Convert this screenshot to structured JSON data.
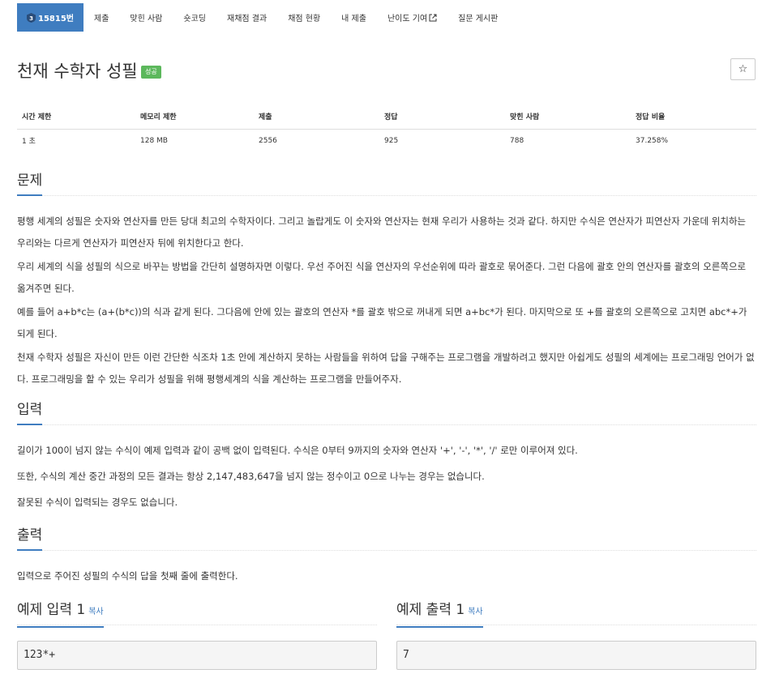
{
  "nav": {
    "problem_id": "15815번",
    "submit": "제출",
    "solved_users": "맞힌 사람",
    "short_coding": "숏코딩",
    "rejudge": "재채점 결과",
    "judge_status": "채점 현황",
    "my_submissions": "내 제출",
    "difficulty": "난이도 기여",
    "board": "질문 게시판",
    "tier_number": "3"
  },
  "header": {
    "title": "천재 수학자 성필",
    "badge": "성공",
    "star": "☆"
  },
  "info_table": {
    "headers": [
      "시간 제한",
      "메모리 제한",
      "제출",
      "정답",
      "맞힌 사람",
      "정답 비율"
    ],
    "values": [
      "1 초",
      "128 MB",
      "2556",
      "925",
      "788",
      "37.258%"
    ]
  },
  "problem": {
    "heading": "문제",
    "paragraphs": [
      "평행 세계의 성필은 숫자와 연산자를 만든 당대 최고의 수학자이다. 그리고 놀랍게도 이 숫자와 연산자는 현재 우리가 사용하는 것과 같다. 하지만 수식은 연산자가 피연산자 가운데 위치하는 우리와는 다르게 연산자가 피연산자 뒤에 위치한다고 한다.",
      "우리 세계의 식을 성필의 식으로 바꾸는 방법을 간단히 설명하자면 이렇다. 우선 주어진 식을 연산자의 우선순위에 따라 괄호로 묶어준다. 그런 다음에 괄호 안의 연산자를 괄호의 오른쪽으로 옮겨주면 된다.",
      "예를 들어 a+b*c는 (a+(b*c))의 식과 같게 된다. 그다음에 안에 있는 괄호의 연산자 *를 괄호 밖으로 꺼내게 되면 a+bc*가 된다. 마지막으로 또 +를 괄호의 오른쪽으로 고치면 abc*+가 되게 된다.",
      "천재 수학자 성필은 자신이 만든 이런 간단한 식조차 1초 안에 계산하지 못하는 사람들을 위하여 답을 구해주는 프로그램을 개발하려고 했지만 아쉽게도 성필의 세계에는 프로그래밍 언어가 없다. 프로그래밍을 할 수 있는 우리가 성필을 위해 평행세계의 식을 계산하는 프로그램을 만들어주자."
    ]
  },
  "input": {
    "heading": "입력",
    "paragraphs": [
      "길이가 100이 넘지 않는 수식이 예제 입력과 같이 공백 없이 입력된다. 수식은 0부터 9까지의 숫자와 연산자 '+', '-', '*', '/' 로만 이루어져 있다.",
      "또한, 수식의 계산 중간 과정의 모든 결과는 항상 2,147,483,647을 넘지 않는 정수이고 0으로 나누는 경우는 없습니다.",
      "잘못된 수식이 입력되는 경우도 없습니다."
    ]
  },
  "output": {
    "heading": "출력",
    "paragraphs": [
      "입력으로 주어진 성필의 수식의 답을 첫째 줄에 출력한다."
    ]
  },
  "examples": {
    "input_heading": "예제 입력 1",
    "output_heading": "예제 출력 1",
    "copy_label": "복사",
    "input_value": "123*+",
    "output_value": "7"
  },
  "colors": {
    "accent": "#3f7dc0",
    "success": "#5cb85c"
  }
}
